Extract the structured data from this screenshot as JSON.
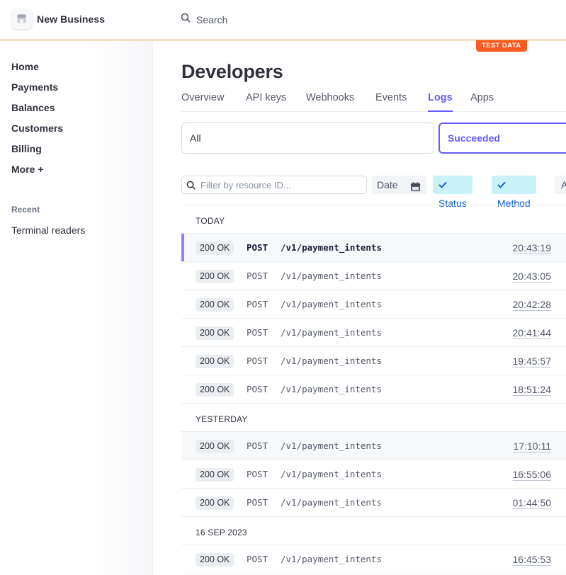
{
  "header": {
    "business_name": "New Business",
    "search_label": "Search",
    "test_badge": "TEST DATA"
  },
  "sidebar": {
    "items": [
      {
        "label": "Home"
      },
      {
        "label": "Payments"
      },
      {
        "label": "Balances"
      },
      {
        "label": "Customers"
      },
      {
        "label": "Billing"
      },
      {
        "label": "More +"
      }
    ],
    "recent_title": "Recent",
    "recent_items": [
      {
        "label": "Terminal readers"
      }
    ]
  },
  "main": {
    "title": "Developers",
    "tabs": [
      {
        "label": "Overview"
      },
      {
        "label": "API keys"
      },
      {
        "label": "Webhooks"
      },
      {
        "label": "Events"
      },
      {
        "label": "Logs",
        "active": true
      },
      {
        "label": "Apps"
      }
    ],
    "filter_cards": [
      {
        "label": "All"
      },
      {
        "label": "Succeeded",
        "selected": true
      }
    ],
    "resource_filter_placeholder": "Filter by resource ID...",
    "filter_pills": {
      "date": "Date",
      "status": "Status",
      "method": "Method",
      "more": "A"
    }
  },
  "logs": {
    "groups": [
      {
        "label": "TODAY",
        "rows": [
          {
            "status": "200 OK",
            "method": "POST",
            "path": "/v1/payment_intents",
            "time": "20:43:19"
          },
          {
            "status": "200 OK",
            "method": "POST",
            "path": "/v1/payment_intents",
            "time": "20:43:05"
          },
          {
            "status": "200 OK",
            "method": "POST",
            "path": "/v1/payment_intents",
            "time": "20:42:28"
          },
          {
            "status": "200 OK",
            "method": "POST",
            "path": "/v1/payment_intents",
            "time": "20:41:44"
          },
          {
            "status": "200 OK",
            "method": "POST",
            "path": "/v1/payment_intents",
            "time": "19:45:57"
          },
          {
            "status": "200 OK",
            "method": "POST",
            "path": "/v1/payment_intents",
            "time": "18:51:24"
          }
        ]
      },
      {
        "label": "YESTERDAY",
        "rows": [
          {
            "status": "200 OK",
            "method": "POST",
            "path": "/v1/payment_intents",
            "time": "17:10:11"
          },
          {
            "status": "200 OK",
            "method": "POST",
            "path": "/v1/payment_intents",
            "time": "16:55:06"
          },
          {
            "status": "200 OK",
            "method": "POST",
            "path": "/v1/payment_intents",
            "time": "01:44:50"
          }
        ]
      },
      {
        "label": "16 SEP 2023",
        "rows": [
          {
            "status": "200 OK",
            "method": "POST",
            "path": "/v1/payment_intents",
            "time": "16:45:53"
          }
        ]
      }
    ]
  }
}
